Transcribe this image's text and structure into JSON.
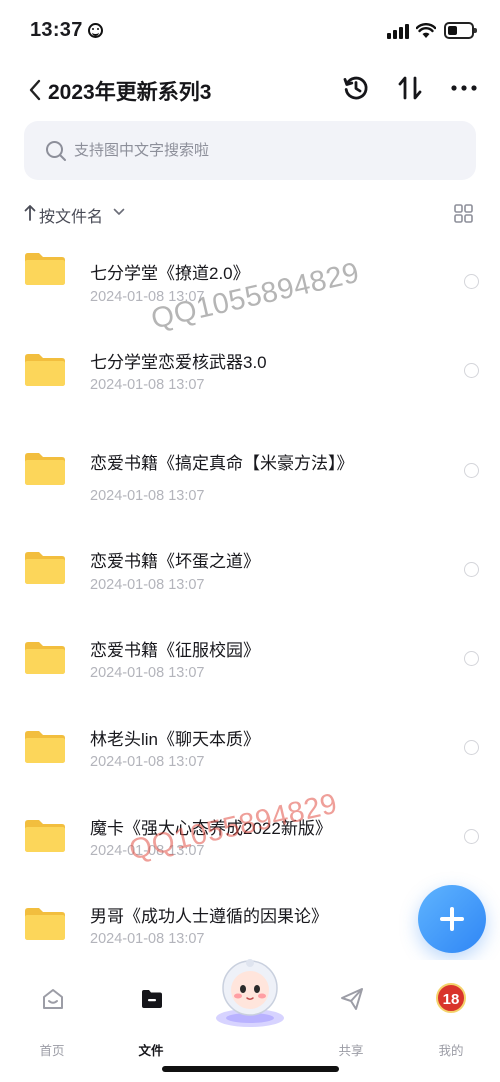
{
  "status_bar": {
    "time": "13:37"
  },
  "nav": {
    "title": "2023年更新系列3"
  },
  "search": {
    "placeholder": "支持图中文字搜索啦"
  },
  "sort": {
    "label": "按文件名"
  },
  "files": [
    {
      "name": "七分学堂《撩道2.0》",
      "date": "2024-01-08 13:07"
    },
    {
      "name": "七分学堂恋爱核武器3.0",
      "date": "2024-01-08 13:07"
    },
    {
      "name": "恋爱书籍《搞定真命【米豪方法】》",
      "date": "2024-01-08 13:07"
    },
    {
      "name": "恋爱书籍《坏蛋之道》",
      "date": "2024-01-08 13:07"
    },
    {
      "name": "恋爱书籍《征服校园》",
      "date": "2024-01-08 13:07"
    },
    {
      "name": "林老头lin《聊天本质》",
      "date": "2024-01-08 13:07"
    },
    {
      "name": "魔卡《强大心态养成2022新版》",
      "date": "2024-01-08 13:07"
    },
    {
      "name": "男哥《成功人士遵循的因果论》",
      "date": "2024-01-08 13:07"
    }
  ],
  "watermarks": [
    "QQ1055894829",
    "QQ1055894829"
  ],
  "tabs": [
    {
      "label": "首页",
      "icon": "home-icon"
    },
    {
      "label": "文件",
      "icon": "folder-icon",
      "active": true
    },
    {
      "label": "共享",
      "icon": "send-icon"
    },
    {
      "label": "我的",
      "icon": "avatar"
    }
  ],
  "profile": {
    "avatar_text": "18"
  },
  "colors": {
    "accent": "#2f86f5",
    "folder": "#fcd65a",
    "muted": "#b3b4bb"
  }
}
